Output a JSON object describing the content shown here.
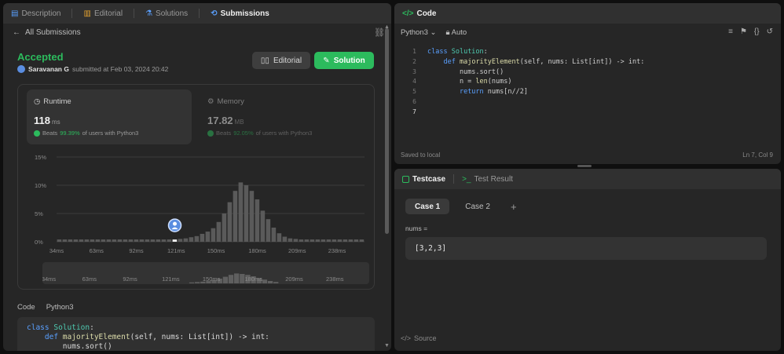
{
  "left_tabs": [
    {
      "icon": "description-icon",
      "glyph": "▤",
      "label": "Description"
    },
    {
      "icon": "editorial-icon",
      "glyph": "📖",
      "label": "Editorial"
    },
    {
      "icon": "solutions-icon",
      "glyph": "⚗",
      "label": "Solutions"
    },
    {
      "icon": "submissions-icon",
      "glyph": "⟲",
      "label": "Submissions"
    }
  ],
  "back": {
    "label": "All Submissions"
  },
  "result": {
    "status": "Accepted",
    "user": "Saravanan G",
    "submitted_text": "submitted at Feb 03, 2024 20:42"
  },
  "buttons": {
    "editorial": "Editorial",
    "solution": "Solution"
  },
  "runtime": {
    "title": "Runtime",
    "value": "118",
    "unit": "ms",
    "beats_prefix": "Beats",
    "beats_pct": "99.39%",
    "beats_suffix": "of users with Python3"
  },
  "memory": {
    "title": "Memory",
    "value": "17.82",
    "unit": "MB",
    "beats_prefix": "Beats",
    "beats_pct": "92.05%",
    "beats_suffix": "of users with Python3"
  },
  "chart_data": {
    "type": "bar",
    "title": "",
    "xlabel": "",
    "ylabel": "",
    "y_ticks": [
      "15%",
      "10%",
      "5%",
      "0%"
    ],
    "ylim": [
      0,
      15
    ],
    "x_tick_labels": [
      "34ms",
      "63ms",
      "92ms",
      "121ms",
      "150ms",
      "180ms",
      "209ms",
      "238ms"
    ],
    "x_ticks_ms": [
      34,
      63,
      92,
      121,
      150,
      180,
      209,
      238
    ],
    "xlim": [
      34,
      258
    ],
    "bin_ms": 4,
    "values": [
      0.4,
      0.4,
      0.4,
      0.4,
      0.4,
      0.4,
      0.4,
      0.4,
      0.4,
      0.4,
      0.4,
      0.4,
      0.4,
      0.4,
      0.4,
      0.4,
      0.4,
      0.4,
      0.4,
      0.4,
      0.4,
      0.4,
      0.5,
      0.6,
      0.8,
      1.0,
      1.4,
      1.8,
      2.4,
      3.5,
      5.0,
      7.0,
      9.0,
      10.5,
      10.0,
      9.0,
      7.5,
      5.5,
      4.0,
      2.5,
      1.5,
      0.9,
      0.6,
      0.5,
      0.4,
      0.4,
      0.4,
      0.4,
      0.4,
      0.4,
      0.4,
      0.4,
      0.4,
      0.4,
      0.4,
      0.4
    ],
    "highlight_ms": 118,
    "grid": true
  },
  "mini_ticks": [
    "34ms",
    "63ms",
    "92ms",
    "121ms",
    "150ms",
    "180ms",
    "209ms",
    "238ms"
  ],
  "code_section": {
    "label": "Code",
    "language": "Python3"
  },
  "code_preview_lines": [
    "class Solution:",
    "    def majorityElement(self, nums: List[int]) -> int:",
    "        nums.sort()"
  ],
  "code_panel": {
    "title": "Code",
    "language": "Python3",
    "mode": "Auto",
    "status": "Saved to local",
    "position": "Ln 7, Col 9",
    "lines": [
      "1",
      "2",
      "3",
      "4",
      "5",
      "6",
      "7"
    ]
  },
  "testcase": {
    "tab_active": "Testcase",
    "tab_other": "Test Result",
    "cases": [
      "Case 1",
      "Case 2"
    ],
    "add": "+",
    "var_label": "nums =",
    "var_value": "[3,2,3]",
    "source": "Source"
  }
}
